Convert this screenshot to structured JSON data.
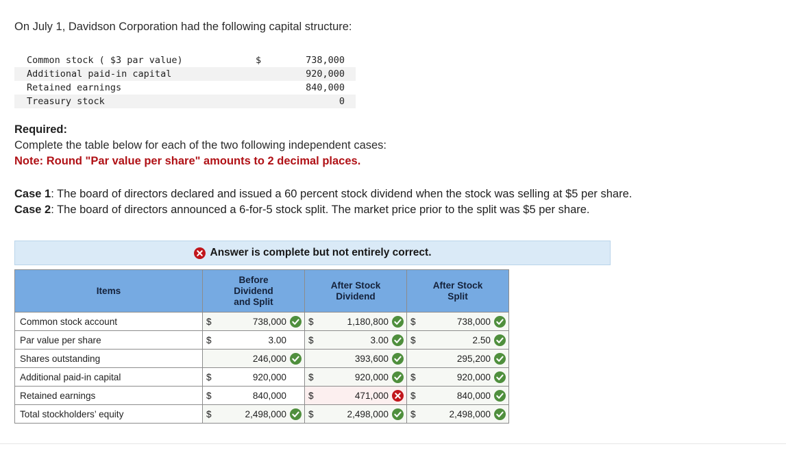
{
  "intro": "On July 1, Davidson Corporation had the following capital structure:",
  "capital_structure": {
    "rows": [
      {
        "label": "Common stock ( $3 par value)",
        "currency": "$",
        "amount": "738,000"
      },
      {
        "label": "Additional paid-in capital",
        "currency": "",
        "amount": "920,000"
      },
      {
        "label": "Retained earnings",
        "currency": "",
        "amount": "840,000"
      },
      {
        "label": "Treasury stock",
        "currency": "",
        "amount": "0"
      }
    ]
  },
  "required": {
    "title": "Required:",
    "line": "Complete the table below for each of the two following independent cases:",
    "note": "Note: Round \"Par value per share\" amounts to 2 decimal places."
  },
  "cases": [
    {
      "label": "Case 1",
      "text": ": The board of directors declared and issued a 60 percent stock dividend when the stock was selling at $5 per share."
    },
    {
      "label": "Case 2",
      "text": ": The board of directors announced a 6-for-5 stock split. The market price prior to the split was $5 per share."
    }
  ],
  "banner": {
    "icon": "error-circle-icon",
    "text": "Answer is complete but not entirely correct."
  },
  "answer_table": {
    "headers": [
      "Items",
      "Before\nDividend\nand Split",
      "After Stock\nDividend",
      "After Stock\nSplit"
    ],
    "header_lines": [
      [
        "Items"
      ],
      [
        "Before",
        "Dividend",
        "and Split"
      ],
      [
        "After Stock",
        "Dividend"
      ],
      [
        "After Stock",
        "Split"
      ]
    ],
    "rows": [
      {
        "item": "Common stock account",
        "cells": [
          {
            "currency": "$",
            "value": "738,000",
            "status": "correct"
          },
          {
            "currency": "$",
            "value": "1,180,800",
            "status": "correct"
          },
          {
            "currency": "$",
            "value": "738,000",
            "status": "correct"
          }
        ]
      },
      {
        "item": "Par value per share",
        "cells": [
          {
            "currency": "$",
            "value": "3.00",
            "status": "none"
          },
          {
            "currency": "$",
            "value": "3.00",
            "status": "correct"
          },
          {
            "currency": "$",
            "value": "2.50",
            "status": "correct"
          }
        ]
      },
      {
        "item": "Shares outstanding",
        "cells": [
          {
            "currency": "",
            "value": "246,000",
            "status": "correct"
          },
          {
            "currency": "",
            "value": "393,600",
            "status": "correct"
          },
          {
            "currency": "",
            "value": "295,200",
            "status": "correct"
          }
        ]
      },
      {
        "item": "Additional paid-in capital",
        "cells": [
          {
            "currency": "$",
            "value": "920,000",
            "status": "none"
          },
          {
            "currency": "$",
            "value": "920,000",
            "status": "correct"
          },
          {
            "currency": "$",
            "value": "920,000",
            "status": "correct"
          }
        ]
      },
      {
        "item": "Retained earnings",
        "cells": [
          {
            "currency": "$",
            "value": "840,000",
            "status": "none"
          },
          {
            "currency": "$",
            "value": "471,000",
            "status": "incorrect"
          },
          {
            "currency": "$",
            "value": "840,000",
            "status": "correct"
          }
        ]
      },
      {
        "item": "Total stockholders’ equity",
        "cells": [
          {
            "currency": "$",
            "value": "2,498,000",
            "status": "correct"
          },
          {
            "currency": "$",
            "value": "2,498,000",
            "status": "correct"
          },
          {
            "currency": "$",
            "value": "2,498,000",
            "status": "correct"
          }
        ]
      }
    ]
  },
  "colors": {
    "header_blue": "#76aae2",
    "banner_blue": "#daeaf7",
    "correct_green": "#4f8f3d",
    "incorrect_red": "#c1161c",
    "note_red": "#b01116"
  }
}
